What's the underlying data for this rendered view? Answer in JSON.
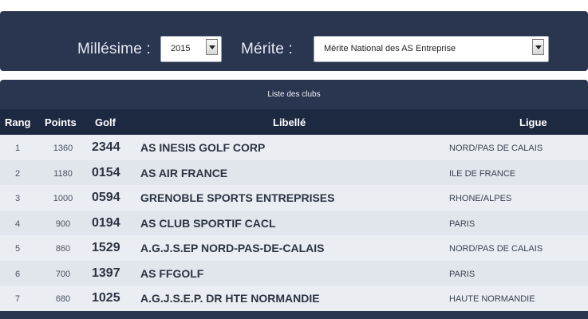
{
  "filters": {
    "millesime_label": "Millésime :",
    "millesime_value": "2015",
    "merite_label": "Mérite :",
    "merite_value": "Mérite National des AS Entreprise"
  },
  "list": {
    "title": "Liste des clubs",
    "columns": {
      "rang": "Rang",
      "points": "Points",
      "golf": "Golf",
      "libelle": "Libellé",
      "ligue": "Ligue"
    },
    "rows": [
      {
        "rang": "1",
        "points": "1360",
        "golf": "2344",
        "libelle": "AS INESIS GOLF CORP",
        "ligue": "NORD/PAS DE CALAIS"
      },
      {
        "rang": "2",
        "points": "1180",
        "golf": "0154",
        "libelle": "AS AIR FRANCE",
        "ligue": "ILE DE FRANCE"
      },
      {
        "rang": "3",
        "points": "1000",
        "golf": "0594",
        "libelle": "GRENOBLE SPORTS ENTREPRISES",
        "ligue": "RHONE/ALPES"
      },
      {
        "rang": "4",
        "points": "900",
        "golf": "0194",
        "libelle": "AS CLUB SPORTIF CACL",
        "ligue": "PARIS"
      },
      {
        "rang": "5",
        "points": "860",
        "golf": "1529",
        "libelle": "A.G.J.S.EP NORD-PAS-DE-CALAIS",
        "ligue": "NORD/PAS DE CALAIS"
      },
      {
        "rang": "6",
        "points": "700",
        "golf": "1397",
        "libelle": "AS FFGOLF",
        "ligue": "PARIS"
      },
      {
        "rang": "7",
        "points": "680",
        "golf": "1025",
        "libelle": "A.G.J.S.E.P. DR HTE NORMANDIE",
        "ligue": "HAUTE NORMANDIE"
      }
    ]
  },
  "colors": {
    "panel": "#2a3650",
    "header_row": "#1d2841",
    "row_bg": "#eaedf2"
  }
}
